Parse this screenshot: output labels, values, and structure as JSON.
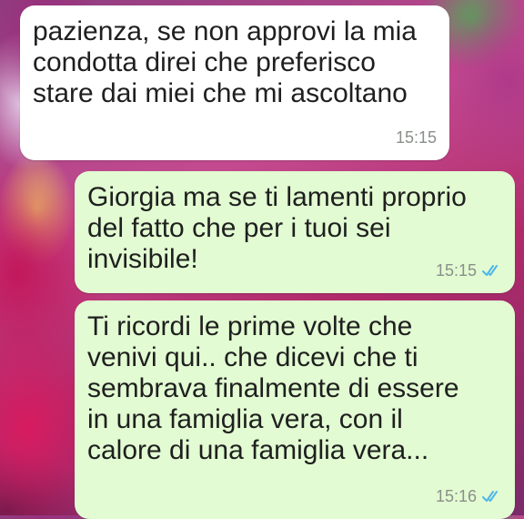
{
  "messages": [
    {
      "direction": "incoming",
      "text": "pazienza, se non approvi la mia\ncondotta direi che preferisco\nstare dai miei che mi ascoltano",
      "time": "15:15"
    },
    {
      "direction": "outgoing",
      "text": "Giorgia ma se ti lamenti proprio\ndel fatto che per i tuoi sei\ninvisibile!",
      "time": "15:15",
      "status_icon": "double-check-read-icon"
    },
    {
      "direction": "outgoing",
      "text": "Ti ricordi le prime volte  che\nvenivi qui.. che dicevi che ti\nsembrava finalmente di essere\nin una famiglia vera, con il\ncalore di una famiglia vera...",
      "time": "15:16",
      "status_icon": "double-check-read-icon"
    }
  ],
  "colors": {
    "incoming_bubble": "#ffffff",
    "outgoing_bubble": "#e2fbd2",
    "read_check": "#4fb6ec",
    "timestamp": "#8a8f8a"
  }
}
